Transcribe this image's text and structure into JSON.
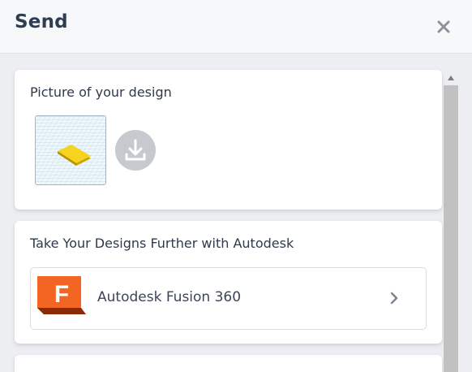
{
  "dialog": {
    "title": "Send",
    "close_icon": "close-icon"
  },
  "design_card": {
    "heading": "Picture of your design",
    "download_icon": "download-icon"
  },
  "autodesk_card": {
    "heading": "Take Your Designs Further with Autodesk",
    "product": {
      "name": "Autodesk Fusion 360",
      "logo_letter": "F",
      "chevron_icon": "chevron-right-icon"
    }
  },
  "colors": {
    "header_bg": "#f7f8fa",
    "page_bg": "#eceef2",
    "title_text": "#2e3d52",
    "download_button": "#c6c9ce",
    "fusion_orange": "#f26522",
    "design_yellow": "#f5d31e"
  }
}
